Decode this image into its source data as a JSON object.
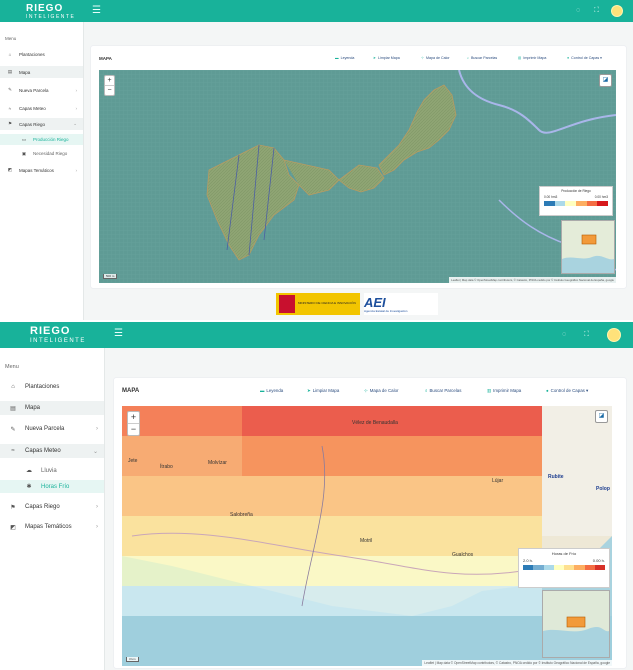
{
  "brand": {
    "title": "RIEGO",
    "subtitle": "INTELIGENTE"
  },
  "colors": {
    "topbar": "#18b29a",
    "accent": "#18b29a",
    "link": "#2b4c7e"
  },
  "screen1": {
    "menu_caption": "Menu",
    "sidebar": [
      {
        "label": "Plantaciones",
        "icon": "home-icon"
      },
      {
        "label": "Mapa",
        "icon": "map-icon"
      },
      {
        "label": "Nueva Parcela",
        "icon": "edit-icon"
      },
      {
        "label": "Capas Meteo",
        "icon": "weather-icon"
      },
      {
        "label": "Capas Riego",
        "icon": "irrigation-icon"
      },
      {
        "label": "Producción Riego",
        "icon": "chart-icon"
      },
      {
        "label": "Necesidad Riego",
        "icon": "drop-icon"
      },
      {
        "label": "Mapas Temáticos",
        "icon": "grid-icon"
      }
    ],
    "card_title": "MAPA",
    "toolbar": [
      "Leyenda",
      "Limpiar Mapa",
      "Mapa de Calor",
      "Buscar Parcelas",
      "Imprimir Mapa",
      "Control de Capas"
    ],
    "legend": {
      "title": "Producción de Riego",
      "min": "0.00 hm3",
      "max": "0.00 hm3",
      "colors": [
        "#2c7bb6",
        "#abd9e9",
        "#ffffbf",
        "#fdae61",
        "#f46d43",
        "#d7191c"
      ]
    },
    "attribution": "Leaflet | Map data © OpenStreetMap contributors, © Catastro, PNOA cedido por © Instituto Geográfico Nacional de España, google",
    "funders": {
      "ministry": "MINISTERIO DE CIENCIA E INNOVACIÓN",
      "aei": "AEI",
      "aei_sub": "Agencia Estatal de Investigación"
    }
  },
  "screen2": {
    "menu_caption": "Menu",
    "sidebar": [
      {
        "label": "Plantaciones",
        "icon": "home-icon"
      },
      {
        "label": "Mapa",
        "icon": "map-icon"
      },
      {
        "label": "Nueva Parcela",
        "icon": "edit-icon"
      },
      {
        "label": "Capas Meteo",
        "icon": "weather-icon"
      },
      {
        "label": "Lluvia",
        "icon": "cloud-icon"
      },
      {
        "label": "Horas Frío",
        "icon": "snow-icon"
      },
      {
        "label": "Capas Riego",
        "icon": "irrigation-icon"
      },
      {
        "label": "Mapas Temáticos",
        "icon": "grid-icon"
      }
    ],
    "card_title": "MAPA",
    "toolbar": [
      "Leyenda",
      "Limpiar Mapa",
      "Mapa de Calor",
      "Buscar Parcelas",
      "Imprimir Mapa",
      "Control de Capas"
    ],
    "legend": {
      "title": "Horas de Frío",
      "min": "2.0 h.",
      "max": "0.00 h.",
      "colors": [
        "#2c7bb6",
        "#74add1",
        "#abd9e9",
        "#ffffbf",
        "#fee090",
        "#fdae61",
        "#f46d43",
        "#d73027"
      ]
    },
    "places": [
      "Vélez de Benaudalla",
      "Jete",
      "Ítrabo",
      "Molvízar",
      "Salobreña",
      "Motril",
      "Gualchos",
      "Lújar",
      "Rubite",
      "Polop"
    ],
    "attribution": "Leaflet | Map data © OpenStreetMap contributors, © Catastro, PNOA cedido por © Instituto Geográfico Nacional de España, google"
  }
}
